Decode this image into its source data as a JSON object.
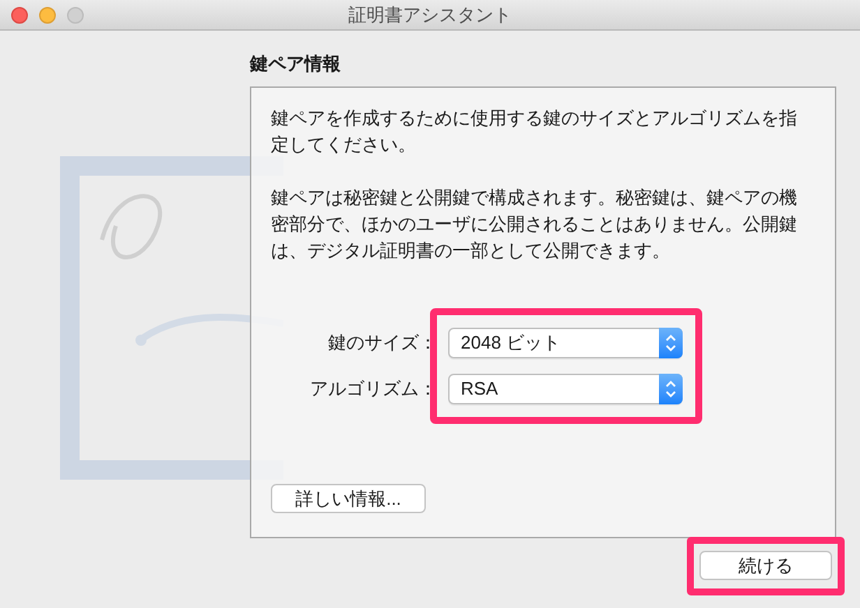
{
  "window": {
    "title": "証明書アシスタント",
    "buttons": [
      {
        "kind": "close"
      },
      {
        "kind": "minimize"
      },
      {
        "kind": "zoom",
        "disabled": true
      }
    ]
  },
  "heading": "鍵ペア情報",
  "paragraphs": [
    "鍵ペアを作成するために使用する鍵のサイズとアルゴリズムを指定してください。",
    "鍵ペアは秘密鍵と公開鍵で構成されます。秘密鍵は、鍵ペアの機密部分で、ほかのユーザに公開されることはありません。公開鍵は、デジタル証明書の一部として公開できます。"
  ],
  "settings": {
    "highlighted": true,
    "fields": [
      {
        "label": "鍵のサイズ：",
        "value": "2048 ビット"
      },
      {
        "label": "アルゴリズム：",
        "value": "RSA"
      }
    ]
  },
  "more_info_button": "詳しい情報...",
  "continue_button": {
    "label": "続ける",
    "highlighted": true
  }
}
